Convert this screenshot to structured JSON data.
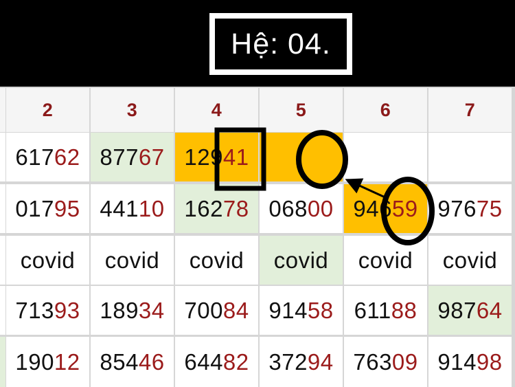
{
  "title": "Hệ: 04.",
  "colors": {
    "header_number": "#8b1a1a",
    "highlight_orange": "#ffbf00",
    "highlight_green": "#e2efda",
    "digit_tail": "#9b1b1b",
    "marker_black": "#000000"
  },
  "headers": [
    "2",
    "3",
    "4",
    "5",
    "6",
    "7"
  ],
  "rows": [
    [
      {
        "head": "617",
        "tail": "62",
        "bg": "white"
      },
      {
        "head": "877",
        "tail": "67",
        "bg": "green"
      },
      {
        "head": "129",
        "tail": "41",
        "bg": "orange"
      },
      {
        "head": "",
        "tail": "",
        "bg": "orange"
      },
      {
        "head": "",
        "tail": "",
        "bg": "white"
      },
      {
        "head": "",
        "tail": "",
        "bg": "white"
      }
    ],
    [
      {
        "head": "017",
        "tail": "95",
        "bg": "white"
      },
      {
        "head": "441",
        "tail": "10",
        "bg": "white"
      },
      {
        "head": "162",
        "tail": "78",
        "bg": "green"
      },
      {
        "head": "068",
        "tail": "00",
        "bg": "white"
      },
      {
        "head": "946",
        "tail": "59",
        "bg": "orange"
      },
      {
        "head": "976",
        "tail": "75",
        "bg": "white"
      }
    ],
    [
      {
        "head": "covid",
        "tail": "",
        "bg": "white"
      },
      {
        "head": "covid",
        "tail": "",
        "bg": "white"
      },
      {
        "head": "covid",
        "tail": "",
        "bg": "white"
      },
      {
        "head": "covid",
        "tail": "",
        "bg": "green"
      },
      {
        "head": "covid",
        "tail": "",
        "bg": "white"
      },
      {
        "head": "covid",
        "tail": "",
        "bg": "white"
      }
    ],
    [
      {
        "head": "713",
        "tail": "93",
        "bg": "white"
      },
      {
        "head": "189",
        "tail": "34",
        "bg": "white"
      },
      {
        "head": "700",
        "tail": "84",
        "bg": "white"
      },
      {
        "head": "914",
        "tail": "58",
        "bg": "white"
      },
      {
        "head": "611",
        "tail": "88",
        "bg": "white"
      },
      {
        "head": "987",
        "tail": "64",
        "bg": "green"
      }
    ],
    [
      {
        "head": "190",
        "tail": "12",
        "bg": "white"
      },
      {
        "head": "854",
        "tail": "46",
        "bg": "white"
      },
      {
        "head": "644",
        "tail": "82",
        "bg": "white"
      },
      {
        "head": "372",
        "tail": "94",
        "bg": "white"
      },
      {
        "head": "763",
        "tail": "09",
        "bg": "white"
      },
      {
        "head": "914",
        "tail": "98",
        "bg": "white"
      }
    ]
  ],
  "left_edge_bg": [
    "header",
    "white",
    "white",
    "white",
    "white",
    "green"
  ],
  "annotations": [
    {
      "type": "square-marker",
      "target": "row-1-col-4-last-digit"
    },
    {
      "type": "circle-marker",
      "target": "row-1-col-5"
    },
    {
      "type": "circle-marker",
      "target": "row-2-col-6-last-digits"
    },
    {
      "type": "arrow",
      "from": "row-2-col-6",
      "to": "row-1-col-5"
    }
  ]
}
